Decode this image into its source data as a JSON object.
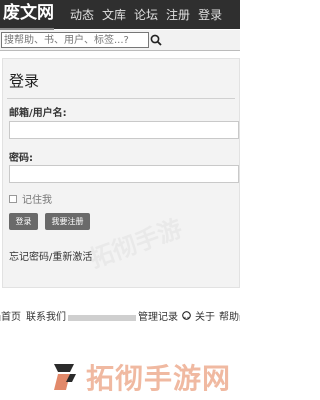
{
  "header": {
    "logo": "废文网",
    "nav": [
      "动态",
      "文库",
      "论坛",
      "注册",
      "登录"
    ]
  },
  "search": {
    "placeholder": "搜帮助、书、用户、标签...?"
  },
  "login": {
    "title": "登录",
    "email_label": "邮箱/用户名:",
    "password_label": "密码:",
    "remember_label": "记住我",
    "login_button": "登录",
    "register_button": "我要注册",
    "forgot_link": "忘记密码/重新激活"
  },
  "footer": {
    "left": [
      "首页",
      "联系我们"
    ],
    "right": [
      "管理记录",
      "关于",
      "帮助"
    ]
  },
  "watermark": {
    "text": "拓彻手游网"
  },
  "colors": {
    "topbar": "#2f2f2f",
    "button": "#6a6a6a",
    "watermark": "#f0b9a1"
  }
}
